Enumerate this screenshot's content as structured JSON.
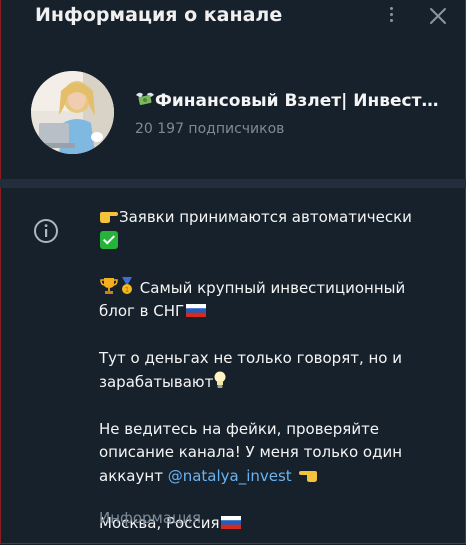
{
  "header": {
    "title": "Информация о канале"
  },
  "channel": {
    "name": "Финансовый Взлет| Инвест…",
    "subscribers": "20 197 подписчиков"
  },
  "description": {
    "line1": "Заявки принимаются автоматически",
    "line2": "Самый крупный инвестиционный блог в СНГ",
    "line3": "Тут о деньгах не только говорят, но и зарабатывают",
    "line4_text": "Не ведитесь на фейки, проверяйте описание канала! У меня только один аккаунт ",
    "line4_link": "@natalya_invest",
    "line5": "Москва, Россия",
    "label": "Информация"
  },
  "icons": {
    "more": "more-vertical-icon",
    "close": "close-icon",
    "info": "info-icon",
    "money_wings": "money-with-wings-icon",
    "pointing_right": "pointing-right-icon",
    "check": "check-mark-icon",
    "trophy": "trophy-icon",
    "medal": "gold-medal-icon",
    "bulb": "light-bulb-icon",
    "flag_ru": "russia-flag-icon"
  },
  "colors": {
    "background": "#17212b",
    "divider": "#232e3c",
    "link": "#6ab2f2",
    "secondary_text": "#7c8a98"
  }
}
